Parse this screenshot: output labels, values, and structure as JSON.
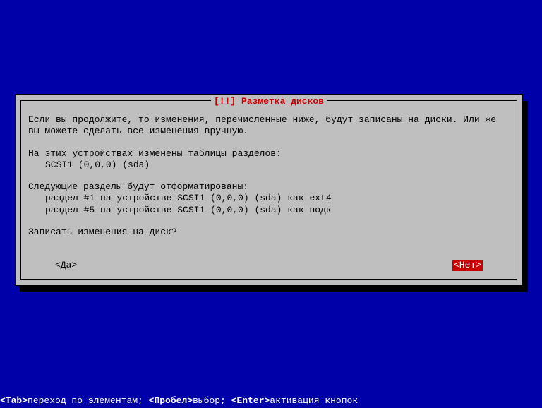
{
  "dialog": {
    "title": "[!!] Разметка дисков",
    "intro": "Если вы продолжите, то изменения, перечисленные ниже, будут записаны на диски. Или же вы можете сделать все изменения вручную.",
    "pt_header": "На этих устройствах изменены таблицы разделов:",
    "pt_items": [
      "SCSI1 (0,0,0) (sda)"
    ],
    "fmt_header": "Следующие разделы будут отформатированы:",
    "fmt_items": [
      "раздел #1 на устройстве SCSI1 (0,0,0) (sda) как ext4",
      "раздел #5 на устройстве SCSI1 (0,0,0) (sda) как подк"
    ],
    "question": "Записать изменения на диск?",
    "yes": "<Да>",
    "no": "<Нет>",
    "selected": "no"
  },
  "footer": {
    "tab_key": "<Tab>",
    "tab_text": "переход по элементам; ",
    "space_key": "<Пробел>",
    "space_text": "выбор; ",
    "enter_key": "<Enter>",
    "enter_text": "активация кнопок"
  }
}
